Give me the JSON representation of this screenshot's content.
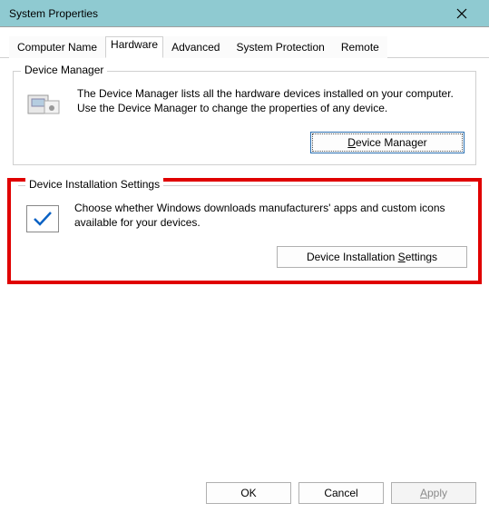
{
  "window": {
    "title": "System Properties"
  },
  "tabs": {
    "t0": "Computer Name",
    "t1": "Hardware",
    "t2": "Advanced",
    "t3": "System Protection",
    "t4": "Remote"
  },
  "device_manager": {
    "title": "Device Manager",
    "desc": "The Device Manager lists all the hardware devices installed on your computer. Use the Device Manager to change the properties of any device.",
    "button": "Device Manager"
  },
  "device_install": {
    "title": "Device Installation Settings",
    "desc": "Choose whether Windows downloads manufacturers' apps and custom icons available for your devices.",
    "button": "Device Installation Settings"
  },
  "footer": {
    "ok": "OK",
    "cancel": "Cancel",
    "apply": "Apply"
  }
}
